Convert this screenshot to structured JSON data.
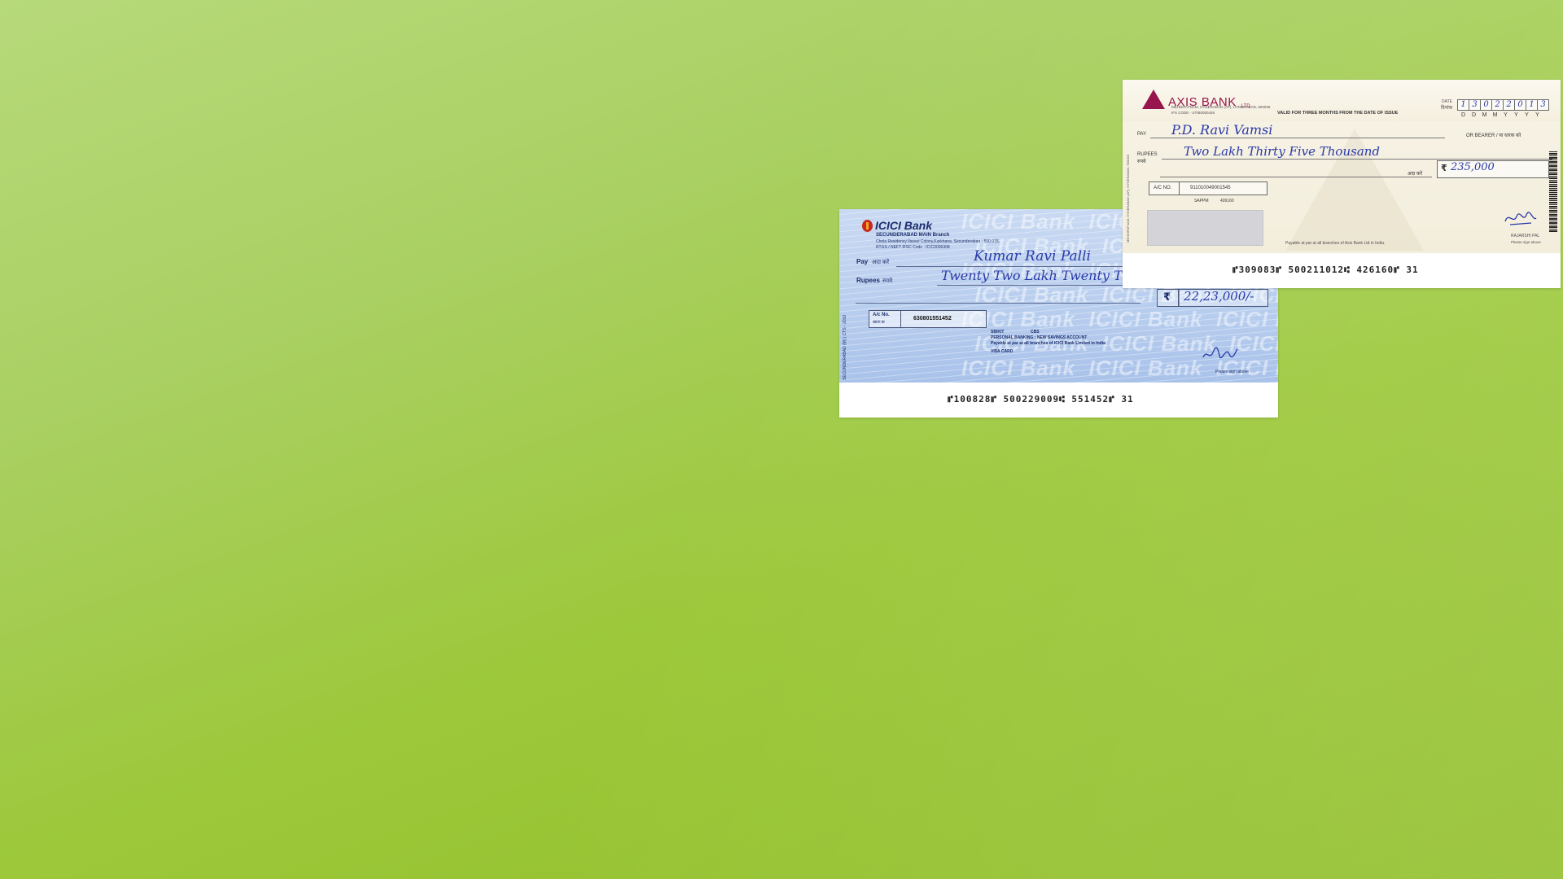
{
  "cheques": {
    "icici": {
      "bank_name": "ICICI Bank",
      "branch": "SECUNDERABAD MAIN Branch",
      "address": "Chola Residency,Vasavi Colony,Karkhana, Secunderabad - 500 015.",
      "ifsc_line": "RTGS / NEFT IFSC Code : ICIC0006308",
      "pay_label": "Pay",
      "pay_label_hindi": "अदा करें",
      "rupees_label": "Rupees",
      "rupees_label_hindi": "रुपये",
      "payee": "Kumar Ravi Palli",
      "amount_words": "Twenty Two Lakh Twenty Th",
      "rupee_symbol": "₹",
      "amount_figures": "22,23,000/-",
      "acno_label": "A/c No.",
      "acno_label_hindi": "खाता क्र",
      "account_number": "630801551452",
      "tag_left": "SBIKIT",
      "tag_right": "CBS",
      "account_type": "PERSONAL BANKING : NEW SAVINGS ACCOUNT",
      "payable_note": "Payable at par at all branches of ICICI Bank Limited in India",
      "card_note": "VISA CARD",
      "sign_note": "Please sign above",
      "side_text": "SECUNDERABAD (M) | CTS - 2010",
      "micr": "⑈100828⑈ 500229009⑆ 551452⑈ 31"
    },
    "axis": {
      "bank_name": "AXIS BANK",
      "bank_suffix": "LTD",
      "branch_line": "MEHDIPATNAM, HYDERABAD (AP), HYDERABAD, 500028",
      "ifs_line": "IFS CODE - UTIB0000426",
      "validity": "VALID FOR THREE MONTHS FROM THE DATE OF ISSUE",
      "date_label": "DATE",
      "date_label_hindi": "दिनांक",
      "date_digits": [
        "1",
        "3",
        "0",
        "2",
        "2",
        "0",
        "1",
        "3"
      ],
      "date_format": [
        "D",
        "D",
        "M",
        "M",
        "Y",
        "Y",
        "Y",
        "Y"
      ],
      "pay_label": "PAY",
      "bearer_label": "OR BEARER / या धारक को",
      "rupees_label": "RUPEES",
      "rupees_label_hindi": "रुपये",
      "payee": "P.D. Ravi Vamsi",
      "amount_words": "Two Lakh Thirty Five Thousand",
      "ada_karen": "अदा करें",
      "rupee_symbol": "₹",
      "amount_figures": "235,000",
      "acno_label": "A/C NO.",
      "account_number": "911010049001545",
      "sub_code": "SAPPM",
      "sub_code_value": "426160",
      "signer": "RAJARSHI PAL",
      "sign_note": "Please sign above",
      "payable_note": "Payable at par at all branches of Axis Bank Ltd in India.",
      "micr": "⑈309083⑈ 500211012⑆ 426160⑈ 31"
    }
  },
  "colors": {
    "background_light": "#b7d97a",
    "background_dark": "#90be28",
    "ink_blue": "#2a3aa8",
    "axis_brand": "#97144d",
    "icici_brand": "#c8281e"
  }
}
